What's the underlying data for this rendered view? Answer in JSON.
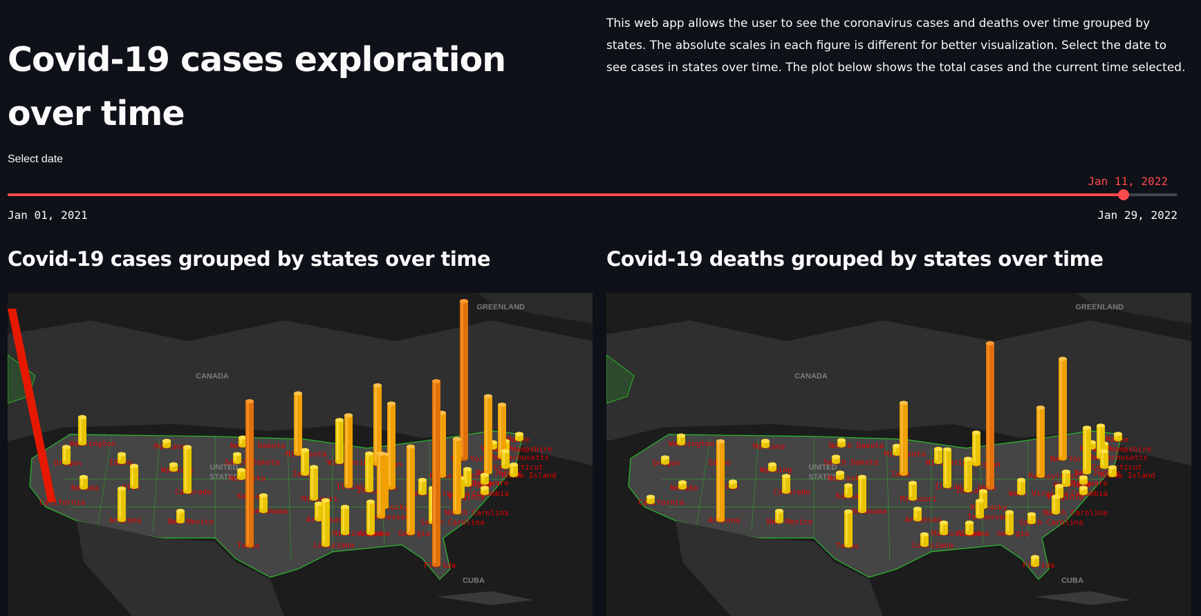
{
  "header": {
    "title": "Covid-19 cases exploration over time",
    "description": "This web app allows the user to see the coronavirus cases and deaths over time grouped by states. The absolute scales in each figure is different for better visualization. Select the date to see cases in states over time. The plot below shows the total cases and the current time selected."
  },
  "slider": {
    "label": "Select date",
    "value": "Jan 11, 2022",
    "min": "Jan 01, 2021",
    "max": "Jan 29, 2022",
    "fraction": 0.954
  },
  "colors": {
    "background": "#0e1117",
    "accent": "#ff4b4b",
    "land": "#454545",
    "border": "#2bbd2b",
    "ocean": "#1c1c1c",
    "bar_low": "#e6c700",
    "bar_mid": "#f08c00",
    "bar_high": "#e61900"
  },
  "maps": [
    {
      "heading": "Covid-19 cases grouped by states over time",
      "geo_labels": [
        "GREENLAND",
        "CANADA",
        "UNITED STATES",
        "CUBA"
      ],
      "states": [
        {
          "name": "Washington",
          "value": 0.1
        },
        {
          "name": "Oregon",
          "value": 0.06
        },
        {
          "name": "California",
          "value": 1.0
        },
        {
          "name": "Nevada",
          "value": 0.04
        },
        {
          "name": "Idaho",
          "value": 0.03
        },
        {
          "name": "Utah",
          "value": 0.08
        },
        {
          "name": "Arizona",
          "value": 0.12
        },
        {
          "name": "Montana",
          "value": 0.02
        },
        {
          "name": "Wyoming",
          "value": 0.02
        },
        {
          "name": "Colorado",
          "value": 0.17
        },
        {
          "name": "New Mexico",
          "value": 0.04
        },
        {
          "name": "North Dakota",
          "value": 0.03
        },
        {
          "name": "South Dakota",
          "value": 0.03
        },
        {
          "name": "Nebraska",
          "value": 0.03
        },
        {
          "name": "Kansas",
          "value": 0.05
        },
        {
          "name": "Oklahoma",
          "value": 0.06
        },
        {
          "name": "Texas",
          "value": 0.55
        },
        {
          "name": "Minnesota",
          "value": 0.23
        },
        {
          "name": "Iowa",
          "value": 0.09
        },
        {
          "name": "Missouri",
          "value": 0.12
        },
        {
          "name": "Arkansas",
          "value": 0.06
        },
        {
          "name": "Louisiana",
          "value": 0.17
        },
        {
          "name": "Wisconsin",
          "value": 0.16
        },
        {
          "name": "Illinois",
          "value": 0.27
        },
        {
          "name": "Michigan",
          "value": 0.3
        },
        {
          "name": "Indiana",
          "value": 0.14
        },
        {
          "name": "Ohio",
          "value": 0.32
        },
        {
          "name": "Kentucky",
          "value": 0.2
        },
        {
          "name": "Tennessee",
          "value": 0.24
        },
        {
          "name": "Mississippi",
          "value": 0.1
        },
        {
          "name": "Alabama",
          "value": 0.12
        },
        {
          "name": "Georgia",
          "value": 0.33
        },
        {
          "name": "Florida",
          "value": 0.7
        },
        {
          "name": "South Carolina",
          "value": 0.13
        },
        {
          "name": "North Carolina",
          "value": 0.28
        },
        {
          "name": "Virginia",
          "value": 0.07
        },
        {
          "name": "West Virginia",
          "value": 0.05
        },
        {
          "name": "Pennsylvania",
          "value": 0.24
        },
        {
          "name": "New York",
          "value": 0.6
        },
        {
          "name": "New Jersey",
          "value": 0.29
        },
        {
          "name": "Maryland",
          "value": 0.06
        },
        {
          "name": "Delaware",
          "value": 0.03
        },
        {
          "name": "Columbia",
          "value": 0.02
        },
        {
          "name": "Massachusetts",
          "value": 0.2
        },
        {
          "name": "Connecticut",
          "value": 0.06
        },
        {
          "name": "Rhode Island",
          "value": 0.04
        },
        {
          "name": "Vermont",
          "value": 0.02
        },
        {
          "name": "New Hampshire",
          "value": 0.03
        },
        {
          "name": "Maine",
          "value": 0.02
        }
      ]
    },
    {
      "heading": "Covid-19 deaths grouped by states over time",
      "geo_labels": [
        "GREENLAND",
        "CANADA",
        "UNITED STATES",
        "CUBA"
      ],
      "states": [
        {
          "name": "Washington",
          "value": 0.03
        },
        {
          "name": "Oregon",
          "value": 0.02
        },
        {
          "name": "California",
          "value": 0.02
        },
        {
          "name": "Nevada",
          "value": 0.02
        },
        {
          "name": "Idaho",
          "value": 0.02
        },
        {
          "name": "Utah",
          "value": 0.02
        },
        {
          "name": "Arizona",
          "value": 0.3
        },
        {
          "name": "Montana",
          "value": 0.02
        },
        {
          "name": "Wyoming",
          "value": 0.02
        },
        {
          "name": "Colorado",
          "value": 0.06
        },
        {
          "name": "New Mexico",
          "value": 0.04
        },
        {
          "name": "North Dakota",
          "value": 0.02
        },
        {
          "name": "South Dakota",
          "value": 0.02
        },
        {
          "name": "Nebraska",
          "value": 0.02
        },
        {
          "name": "Kansas",
          "value": 0.04
        },
        {
          "name": "Oklahoma",
          "value": 0.13
        },
        {
          "name": "Texas",
          "value": 0.13
        },
        {
          "name": "Minnesota",
          "value": 0.03
        },
        {
          "name": "Iowa",
          "value": 0.27
        },
        {
          "name": "Missouri",
          "value": 0.06
        },
        {
          "name": "Arkansas",
          "value": 0.04
        },
        {
          "name": "Louisiana",
          "value": 0.04
        },
        {
          "name": "Wisconsin",
          "value": 0.05
        },
        {
          "name": "Illinois",
          "value": 0.14
        },
        {
          "name": "Michigan",
          "value": 0.12
        },
        {
          "name": "Indiana",
          "value": 0.12
        },
        {
          "name": "Ohio",
          "value": 0.55
        },
        {
          "name": "Kentucky",
          "value": 0.06
        },
        {
          "name": "Tennessee",
          "value": 0.06
        },
        {
          "name": "Mississippi",
          "value": 0.04
        },
        {
          "name": "Alabama",
          "value": 0.04
        },
        {
          "name": "Georgia",
          "value": 0.08
        },
        {
          "name": "Florida",
          "value": 0.03
        },
        {
          "name": "South Carolina",
          "value": 0.03
        },
        {
          "name": "North Carolina",
          "value": 0.06
        },
        {
          "name": "Virginia",
          "value": 0.04
        },
        {
          "name": "West Virginia",
          "value": 0.05
        },
        {
          "name": "Pennsylvania",
          "value": 0.26
        },
        {
          "name": "New York",
          "value": 0.38
        },
        {
          "name": "New Jersey",
          "value": 0.17
        },
        {
          "name": "Maryland",
          "value": 0.05
        },
        {
          "name": "Delaware",
          "value": 0.02
        },
        {
          "name": "Columbia",
          "value": 0.02
        },
        {
          "name": "Massachusetts",
          "value": 0.12
        },
        {
          "name": "Connecticut",
          "value": 0.06
        },
        {
          "name": "Rhode Island",
          "value": 0.03
        },
        {
          "name": "Vermont",
          "value": 0.02
        },
        {
          "name": "New Hampshire",
          "value": 0.02
        },
        {
          "name": "Maine",
          "value": 0.02
        }
      ]
    }
  ]
}
